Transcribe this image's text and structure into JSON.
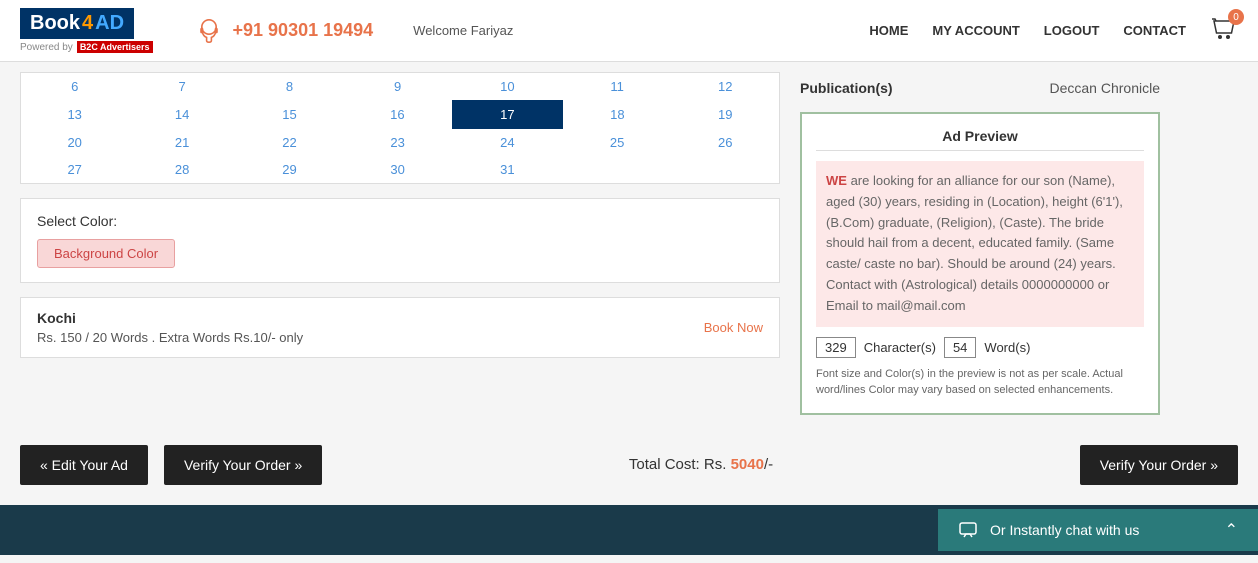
{
  "header": {
    "logo_text": "Book",
    "logo_highlight": "4",
    "logo_ad": "AD",
    "powered_label": "Powered by",
    "b2c_label": "B2C Advertisers",
    "phone": "+91 90301 19494",
    "welcome": "Welcome Fariyaz",
    "nav": {
      "home": "HOME",
      "my_account": "MY ACCOUNT",
      "logout": "LOGOUT",
      "contact": "CONTACT"
    },
    "cart_count": "0"
  },
  "calendar": {
    "rows": [
      [
        "6",
        "7",
        "8",
        "9",
        "10",
        "11",
        "12"
      ],
      [
        "13",
        "14",
        "15",
        "16",
        "17",
        "18",
        "19"
      ],
      [
        "20",
        "21",
        "22",
        "23",
        "24",
        "25",
        "26"
      ],
      [
        "27",
        "28",
        "29",
        "30",
        "31",
        "",
        ""
      ]
    ],
    "selected_day": "17"
  },
  "select_color": {
    "title": "Select Color:",
    "button_label": "Background Color"
  },
  "kochi": {
    "title": "Kochi",
    "price_text": "Rs. 150 / 20 Words . Extra Words Rs.10/- only",
    "book_now": "Book Now"
  },
  "bottom": {
    "edit_ad": "« Edit Your Ad",
    "verify_order_left": "Verify Your Order »",
    "total_cost_label": "Total Cost: Rs.",
    "total_cost_amount": "5040",
    "total_cost_suffix": "/-",
    "verify_order_right": "Verify Your Order »"
  },
  "right_panel": {
    "publications_label": "Publication(s)",
    "publications_value": "Deccan Chronicle",
    "ad_preview_title": "Ad Preview",
    "ad_text_part1": "WE",
    "ad_text_part2": " are looking for an alliance for our son (Name), aged (30) years, residing in (Location), height (6'1'), (B.Com) graduate, (Religion), (Caste). The bride should hail from a decent, educated family. (Same caste/ caste no bar). Should be around (24) years. Contact with (Astrological) details 0000000000 or Email to mail@mail.com",
    "characters_count": "329",
    "characters_label": "Character(s)",
    "words_count": "54",
    "words_label": "Word(s)",
    "preview_note": "Font size and Color(s) in the preview is not as per scale. Actual word/lines Color may vary based on selected enhancements."
  },
  "footer": {
    "chat_label": "Or Instantly chat with us"
  }
}
